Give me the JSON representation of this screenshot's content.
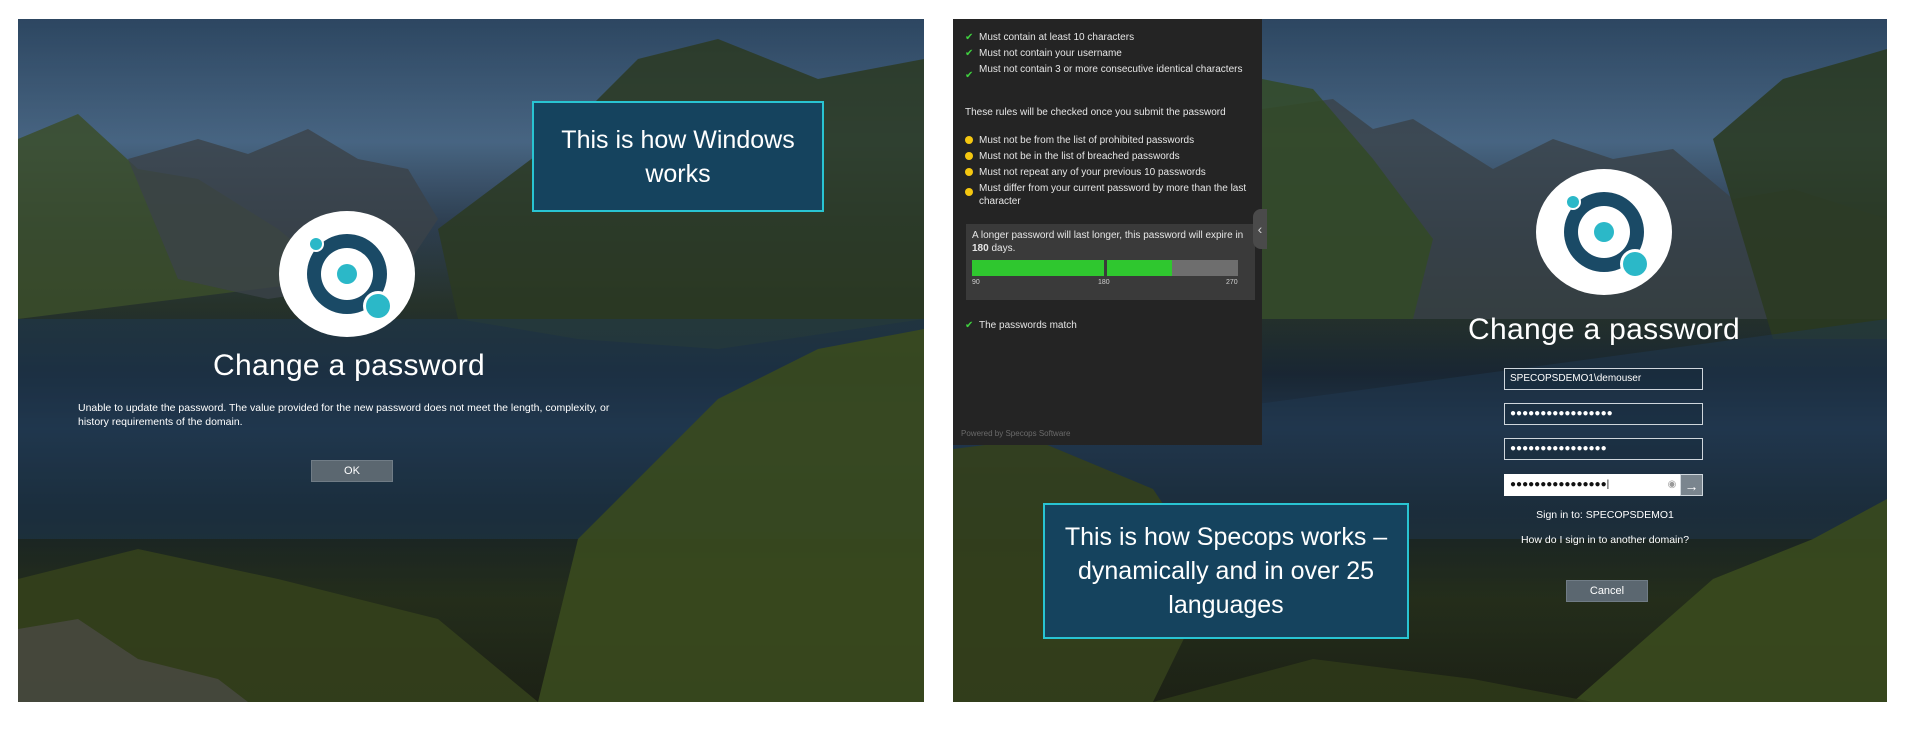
{
  "left": {
    "title": "Change a password",
    "message": "Unable to update the password. The value provided for the new password does not meet the length, complexity, or history requirements of the domain.",
    "ok_label": "OK",
    "callout": "This is how Windows works"
  },
  "right": {
    "rules_met": [
      "Must contain at least 10 characters",
      "Must not contain your username",
      "Must not contain 3 or more consecutive identical characters"
    ],
    "checked_on_submit_heading": "These rules will be checked once you submit the password",
    "rules_pending": [
      "Must not be from the list of prohibited passwords",
      "Must not be in the list of breached passwords",
      "Must not repeat any of your previous 10 passwords",
      "Must differ from your current password by more than the last character"
    ],
    "expiry_prefix": "A longer password will last longer, this password will expire in",
    "expiry_days": "180",
    "expiry_suffix": "days.",
    "expiry_scale": {
      "min": "90",
      "mid": "180",
      "max": "270"
    },
    "expiry_bar_fraction": 0.75,
    "passwords_match": "The passwords match",
    "powered_by": "Powered by Specops Software",
    "title": "Change a password",
    "username_value": "SPECOPSDEMO1\\demouser",
    "old_password_mask": "●●●●●●●●●●●●●●●●●",
    "new_password_mask": "●●●●●●●●●●●●●●●●",
    "confirm_password_mask": "●●●●●●●●●●●●●●●●|",
    "sign_in_to": "Sign in to: SPECOPSDEMO1",
    "other_domain_link": "How do I sign in to another domain?",
    "cancel_label": "Cancel",
    "callout": "This is how Specops works – dynamically and in over 25 languages"
  },
  "colors": {
    "callout_bg": "#15435e",
    "callout_border": "#29c4d2",
    "check_green": "#3fcf3f",
    "pending_yellow": "#f5c710",
    "bar_green": "#2fc72f",
    "logo_teal": "#2bb8c8",
    "logo_navy": "#1a4a66"
  },
  "icons": [
    "check-icon",
    "pending-dot-icon",
    "eye-icon",
    "arrow-right-icon",
    "chevron-left-icon",
    "specops-logo"
  ]
}
